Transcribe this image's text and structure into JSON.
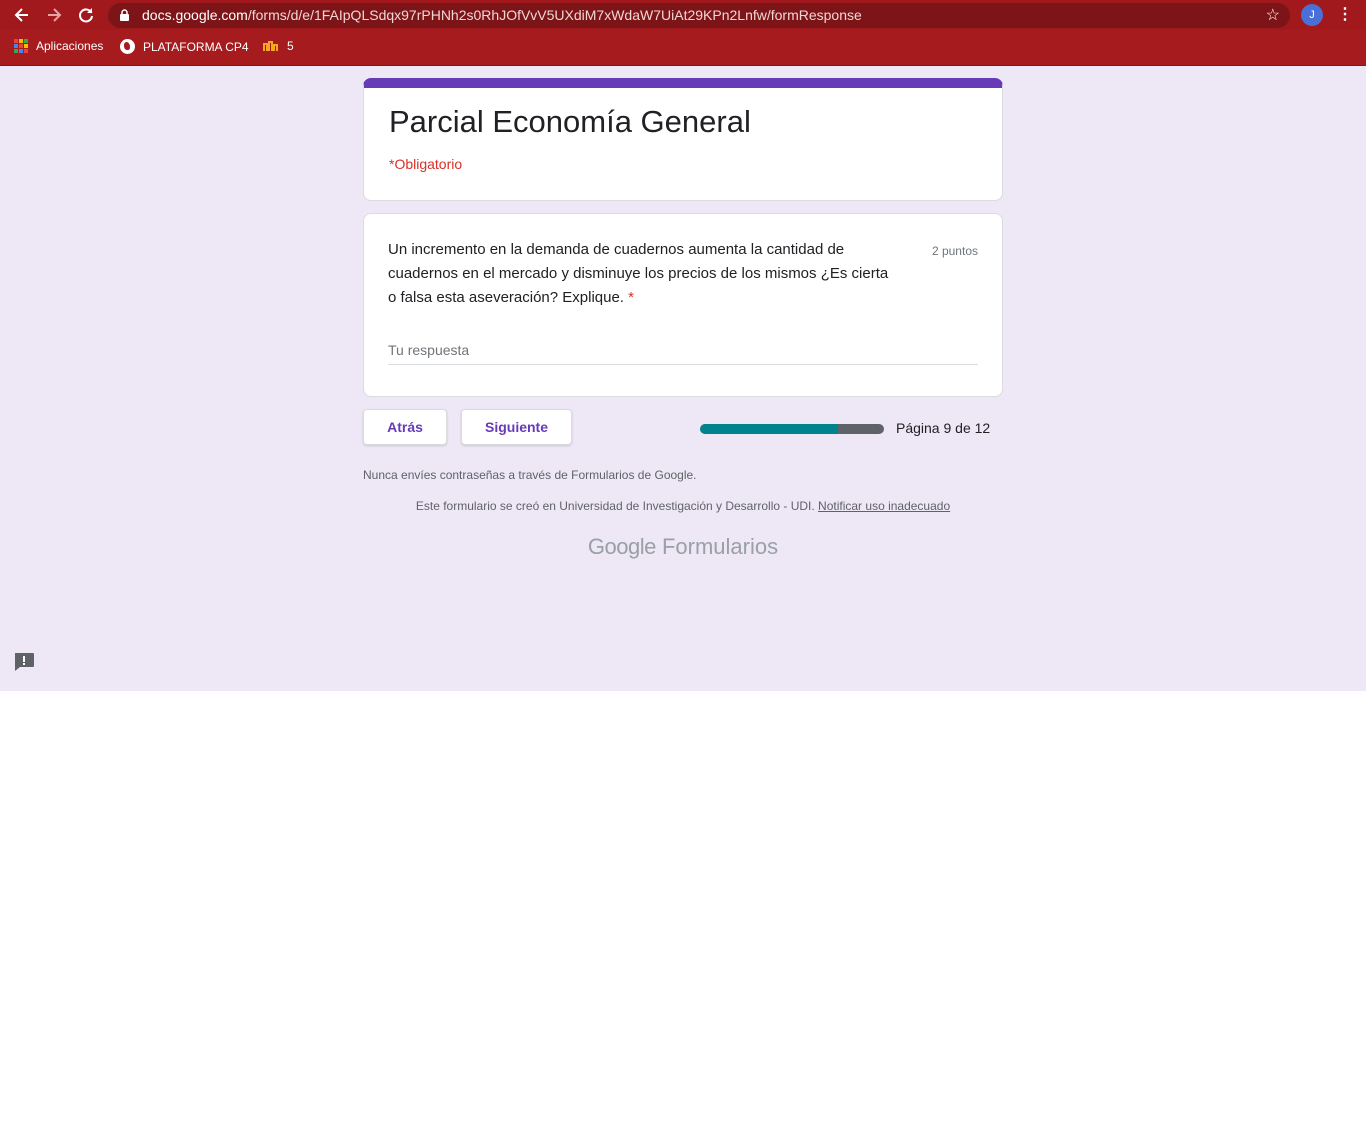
{
  "browser": {
    "url_host": "docs.google.com",
    "url_path": "/forms/d/e/1FAIpQLSdqx97rPHNh2s0RhJOfVvV5UXdiM7xWdaW7UiAt29KPn2Lnfw/formResponse",
    "avatar_letter": "J",
    "icons": [
      "back-arrow-icon",
      "forward-arrow-icon",
      "reload-icon",
      "lock-icon",
      "star-icon",
      "more-vert-icon"
    ]
  },
  "bookmarks": [
    {
      "label": "Aplicaciones",
      "icon": "apps-grid-icon"
    },
    {
      "label": "PLATAFORMA CP4",
      "icon": "globe-icon"
    },
    {
      "label": "5",
      "icon": "m-logo-icon"
    }
  ],
  "form": {
    "title": "Parcial Economía General",
    "required_note": "*Obligatorio",
    "accent_color": "#673ab7",
    "question": {
      "text": "Un incremento en la demanda de cuadernos aumenta la cantidad de cuadernos en el mercado y disminuye los precios de los mismos ¿Es cierta o falsa esta aseveración? Explique.",
      "required_mark": "*",
      "points": "2 puntos",
      "answer_placeholder": "Tu respuesta"
    }
  },
  "navigation": {
    "back_label": "Atrás",
    "next_label": "Siguiente",
    "page_text": "Página 9 de 12",
    "progress_fraction": 0.75
  },
  "footer": {
    "warning": "Nunca envíes contraseñas a través de Formularios de Google.",
    "created_text": "Este formulario se creó en Universidad de Investigación y Desarrollo - UDI.",
    "report_link": "Notificar uso inadecuado",
    "brand_google": "Google",
    "brand_product": "Formularios"
  }
}
